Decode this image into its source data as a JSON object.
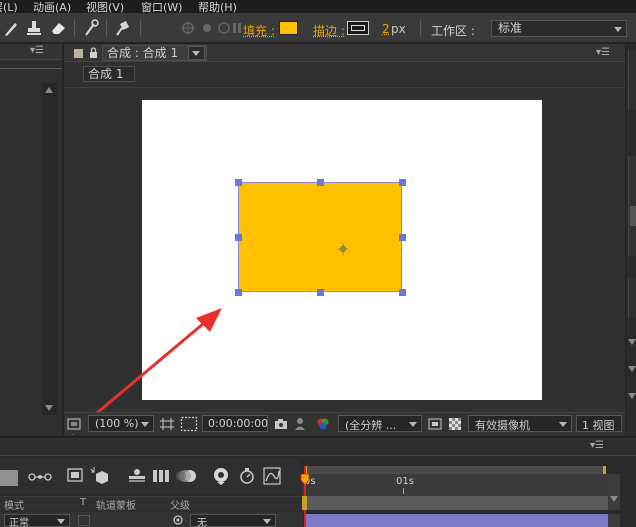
{
  "menu": {
    "items": [
      {
        "label": "层(L)"
      },
      {
        "label": "动画(A)"
      },
      {
        "label": "视图(V)"
      },
      {
        "label": "窗口(W)"
      },
      {
        "label": "帮助(H)"
      }
    ]
  },
  "toolbar": {
    "fill_label": "填充 :",
    "fill_color": "#ffc000",
    "stroke_label": "描边 :",
    "stroke_width": "2",
    "stroke_unit": "px",
    "workspace_label": "工作区 :",
    "workspace_value": "标准"
  },
  "comp_panel": {
    "tab_label": "合成 : 合成 1",
    "sub_tab_label": "合成 1",
    "canvas_color": "#ffffff",
    "shape_color": "#ffc000"
  },
  "statusbar": {
    "zoom": "(100 %)",
    "timecode": "0:00:00:00",
    "resolution": "(全分辨 ...",
    "camera": "有效摄像机",
    "views": "1 视图"
  },
  "timeline": {
    "ruler_start": "0s",
    "ruler_mark": "01s",
    "col_mode": "模式",
    "col_t": "T",
    "col_trkmat": "轨道蒙板",
    "col_parent": "父级",
    "row_mode": "正常",
    "row_parent": "无"
  }
}
